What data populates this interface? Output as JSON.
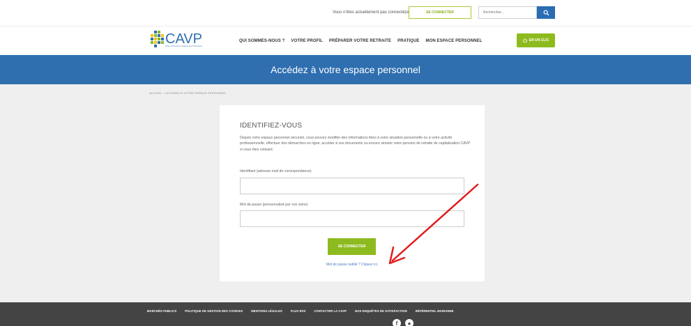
{
  "topbar": {
    "status_text": "Vous n'êtes actuellement pas connecté(e).",
    "connect_label": "SE CONNECTER",
    "search_placeholder": "Rechercher..."
  },
  "header": {
    "logo_text": "CAVP",
    "logo_tagline": "Caisse d'Assurance Vieillesse des Pharmaciens",
    "menu": [
      {
        "label": "QUI SOMMES-NOUS ?"
      },
      {
        "label": "VOTRE PROFIL"
      },
      {
        "label": "PRÉPARER VOTRE RETRAITE"
      },
      {
        "label": "PRATIQUE"
      },
      {
        "label": "MON ESPACE PERSONNEL"
      }
    ],
    "clic_label": "EN UN CLIC"
  },
  "banner": {
    "title": "Accédez à votre espace personnel"
  },
  "breadcrumb": {
    "text": "ACCUEIL  >  ACCÉDEZ À VOTRE ESPACE PERSONNEL"
  },
  "login": {
    "heading": "IDENTIFIEZ-VOUS",
    "intro": "Depuis votre espace personnel sécurisé, vous pouvez modifier des informations liées à votre situation personnelle ou à votre activité professionnelle, effectuer des démarches en ligne, accéder à vos documents ou encore simuler votre pension de retraite de capitalisation CAVP si vous êtes cotisant.",
    "identifier_label": "Identifiant (adresse mail de correspondance)",
    "identifier_value": "",
    "password_label": "Mot de passe (personnalisé par vos soins)",
    "password_value": "",
    "submit_label": "SE CONNECTER",
    "forgot_text": "Mot de passe oublié ? Cliquez ici."
  },
  "footer": {
    "links": [
      {
        "label": "MARCHÉS PUBLICS"
      },
      {
        "label": "POLITIQUE DE GESTION DES COOKIES"
      },
      {
        "label": "MENTIONS LÉGALES"
      },
      {
        "label": "FLUX RSS"
      },
      {
        "label": "CONTACTER LA CAVP"
      },
      {
        "label": "NOS ENQUÊTES DE SATISFACTION"
      },
      {
        "label": "RÉFÉRENTIEL MARIANNE"
      }
    ]
  },
  "colors": {
    "primary_blue": "#2f6fb0",
    "accent_green": "#8dbb1f",
    "annotation_arrow": "#e11b1b",
    "footer_bg": "#444444"
  },
  "icons": {
    "search": "search-icon",
    "clic": "power-icon",
    "social": [
      "facebook-icon",
      "social-icon"
    ]
  }
}
